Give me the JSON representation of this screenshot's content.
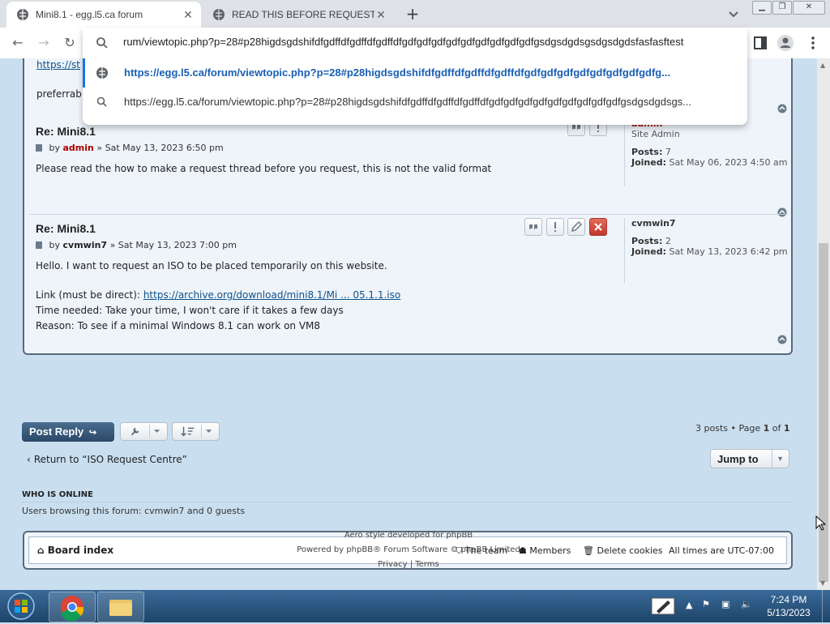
{
  "browser": {
    "tabs": [
      {
        "title": "Mini8.1 - egg.l5.ca forum",
        "active": true
      },
      {
        "title": "READ THIS BEFORE REQUESTING",
        "active": false
      }
    ],
    "omnibox": {
      "input_text": "rum/viewtopic.php?p=28#p28higdsgdshifdfgdffdfgdffdfgdffdfgdfgdfgdfgdfgdfgdfgdfgdfgdfgsdgsdgdsgsdgsdgdsfasfasftest",
      "suggestions": [
        "https://egg.l5.ca/forum/viewtopic.php?p=28#p28higdsgdshifdfgdffdfgdffdfgdffdfgdfgdfgdfgdfgdfgdfgdfgdfg...",
        "https://egg.l5.ca/forum/viewtopic.php?p=28#p28higdsgdshifdfgdffdfgdffdfgdffdfgdfgdfgdfgdfgdfgdfgdfgdfgdfgsdgsdgdsgs..."
      ]
    }
  },
  "partial": {
    "link_text": "https://st",
    "text": "preferrabl"
  },
  "posts": [
    {
      "title": "Re: Mini8.1",
      "by": "by",
      "author": "admin",
      "date": "» Sat May 13, 2023 6:50 pm",
      "content": "Please read the how to make a request thread before you request, this is not the valid format",
      "sidebar": {
        "username": "admin",
        "rank": "Site Admin",
        "posts_label": "Posts:",
        "posts": "7",
        "joined_label": "Joined:",
        "joined": "Sat May 06, 2023 4:50 am"
      }
    },
    {
      "title": "Re: Mini8.1",
      "by": "by",
      "author": "cvmwin7",
      "date": "» Sat May 13, 2023 7:00 pm",
      "content_intro": "Hello. I want to request an ISO to be placed temporarily on this website.",
      "link_label": "Link (must be direct):",
      "link": "https://archive.org/download/mini8.1/Mi ... 05.1.1.iso",
      "time_needed": "Time needed: Take your time, I won't care if it takes a few days",
      "reason": "Reason: To see if a minimal Windows 8.1 can work on VM8",
      "sidebar": {
        "username": "cvmwin7",
        "posts_label": "Posts:",
        "posts": "2",
        "joined_label": "Joined:",
        "joined": "Sat May 13, 2023 6:42 pm"
      }
    }
  ],
  "actions": {
    "post_reply": "Post Reply",
    "pagination_prefix": "3 posts • Page",
    "page": "1",
    "of": "of",
    "pages": "1",
    "return_link": "Return to “ISO Request Centre”",
    "jump_to": "Jump to"
  },
  "who_online": {
    "title": "WHO IS ONLINE",
    "text": "Users browsing this forum: cvmwin7 and 0 guests"
  },
  "footer_nav": {
    "board_index": "Board index",
    "team": "The team",
    "members": "Members",
    "delete_cookies": "Delete cookies",
    "timezone": "All times are UTC-07:00"
  },
  "credits": {
    "style": "Aero style developed for phpBB",
    "powered": "Powered by phpBB® Forum Software © phpBB Limited",
    "privacy": "Privacy",
    "sep": "|",
    "terms": "Terms"
  },
  "taskbar": {
    "time": "7:24 PM",
    "date": "5/13/2023"
  },
  "colors": {
    "admin_name": "#aa0000",
    "accent_blue": "#1a73e8",
    "post_reply_bg": "#2b4868"
  }
}
